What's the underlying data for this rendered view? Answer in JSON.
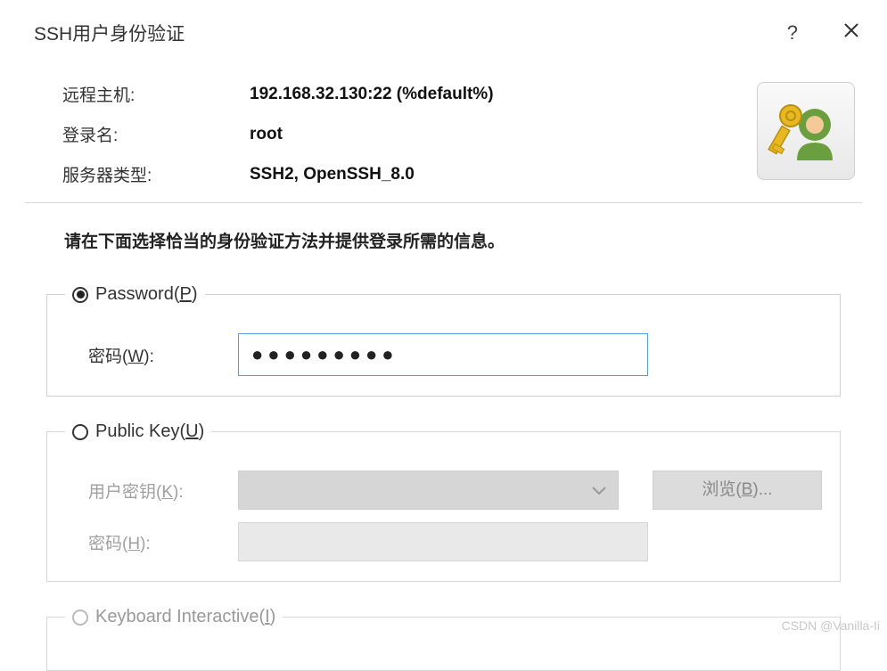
{
  "title": "SSH用户身份验证",
  "help_symbol": "?",
  "info": {
    "remote_host_label": "远程主机:",
    "remote_host_value": "192.168.32.130:22 (%default%)",
    "login_label": "登录名:",
    "login_value": "root",
    "server_type_label": "服务器类型:",
    "server_type_value": "SSH2, OpenSSH_8.0"
  },
  "prompt": "请在下面选择恰当的身份验证方法并提供登录所需的信息。",
  "methods": {
    "password": {
      "legend_prefix": "Password(",
      "legend_key": "P",
      "legend_suffix": ")",
      "pw_label_prefix": "密码(",
      "pw_label_key": "W",
      "pw_label_suffix": "):",
      "pw_value": "●●●●●●●●●"
    },
    "publickey": {
      "legend_prefix": "Public Key(",
      "legend_key": "U",
      "legend_suffix": ")",
      "userkey_label_prefix": "用户密钥(",
      "userkey_label_key": "K",
      "userkey_label_suffix": "):",
      "pw_label_prefix": "密码(",
      "pw_label_key": "H",
      "pw_label_suffix": "):",
      "browse_prefix": "浏览(",
      "browse_key": "B",
      "browse_suffix": ")..."
    },
    "keyboard": {
      "legend_prefix": "Keyboard Interactive(",
      "legend_key": "I",
      "legend_suffix": ")"
    }
  },
  "watermark": "CSDN @Vanilla-Ii"
}
